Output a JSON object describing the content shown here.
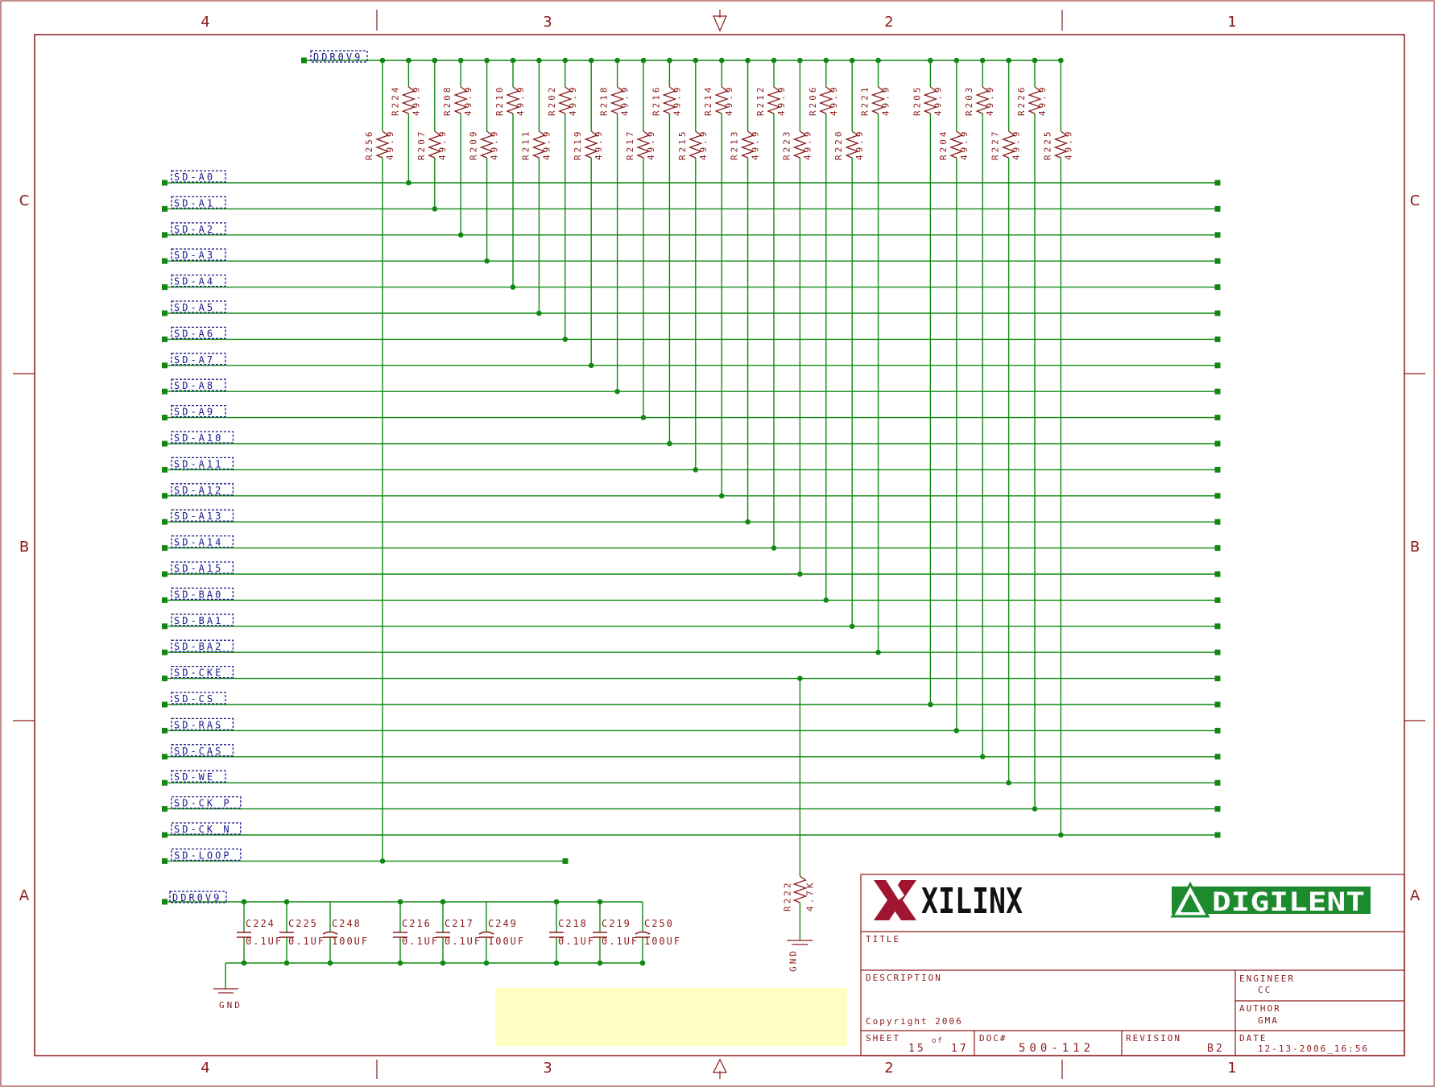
{
  "frame": {
    "columns": [
      "4",
      "3",
      "2",
      "1"
    ],
    "rows": [
      "C",
      "B",
      "A"
    ]
  },
  "power_net": "DDR0V9",
  "signals": [
    "SD-A0",
    "SD-A1",
    "SD-A2",
    "SD-A3",
    "SD-A4",
    "SD-A5",
    "SD-A6",
    "SD-A7",
    "SD-A8",
    "SD-A9",
    "SD-A10",
    "SD-A11",
    "SD-A12",
    "SD-A13",
    "SD-A14",
    "SD-A15",
    "SD-BA0",
    "SD-BA1",
    "SD-BA2",
    "SD-CKE",
    "SD-CS",
    "SD-RAS",
    "SD-CAS",
    "SD-WE",
    "SD-CK_P",
    "SD-CK_N",
    "SD-LOOP"
  ],
  "resistors_top": [
    {
      "name": "R224",
      "value": "49.9"
    },
    {
      "name": "R208",
      "value": "49.9"
    },
    {
      "name": "R210",
      "value": "49.9"
    },
    {
      "name": "R202",
      "value": "49.9"
    },
    {
      "name": "R218",
      "value": "49.9"
    },
    {
      "name": "R216",
      "value": "49.9"
    },
    {
      "name": "R214",
      "value": "49.9"
    },
    {
      "name": "R212",
      "value": "49.9"
    },
    {
      "name": "R206",
      "value": "49.9"
    },
    {
      "name": "R221",
      "value": "49.9"
    },
    {
      "name": "R205",
      "value": "49.9"
    },
    {
      "name": "R203",
      "value": "49.9"
    },
    {
      "name": "R226",
      "value": "49.9"
    }
  ],
  "resistors_bottom": [
    {
      "name": "R256",
      "value": "49.9"
    },
    {
      "name": "R207",
      "value": "49.9"
    },
    {
      "name": "R209",
      "value": "49.9"
    },
    {
      "name": "R211",
      "value": "49.9"
    },
    {
      "name": "R219",
      "value": "49.9"
    },
    {
      "name": "R217",
      "value": "49.9"
    },
    {
      "name": "R215",
      "value": "49.9"
    },
    {
      "name": "R213",
      "value": "49.9"
    },
    {
      "name": "R223",
      "value": "49.9"
    },
    {
      "name": "R220",
      "value": "49.9"
    },
    {
      "name": "R204",
      "value": "49.9"
    },
    {
      "name": "R227",
      "value": "49.9"
    },
    {
      "name": "R225",
      "value": "49.9"
    }
  ],
  "pulldown": {
    "name": "R222",
    "value": "4.7K",
    "ground": "GND"
  },
  "capacitors": [
    {
      "name": "C224",
      "value": "0.1UF"
    },
    {
      "name": "C225",
      "value": "0.1UF"
    },
    {
      "name": "C248",
      "value": "100UF"
    },
    {
      "name": "C216",
      "value": "0.1UF"
    },
    {
      "name": "C217",
      "value": "0.1UF"
    },
    {
      "name": "C249",
      "value": "100UF"
    },
    {
      "name": "C218",
      "value": "0.1UF"
    },
    {
      "name": "C219",
      "value": "0.1UF"
    },
    {
      "name": "C250",
      "value": "100UF"
    }
  ],
  "cap_ground": "GND",
  "title_block": {
    "logo_left": "XILINX",
    "logo_right": "DIGILENT",
    "title_label": "TITLE",
    "description_label": "DESCRIPTION",
    "copyright": "Copyright 2006",
    "engineer_label": "ENGINEER",
    "engineer": "CC",
    "author_label": "AUTHOR",
    "author": "GMA",
    "sheet_label": "SHEET",
    "sheet": "15",
    "of_label": "of",
    "sheet_total": "17",
    "doc_label": "DOC#",
    "doc": "500-112",
    "revision_label": "REVISION",
    "revision": "B2",
    "date_label": "DATE",
    "date": "12-13-2006_16:56"
  },
  "colors": {
    "frame": "#8b1a1a",
    "wire": "#118811",
    "net_label": "#1a1a8b",
    "note": "#ffffc4"
  }
}
